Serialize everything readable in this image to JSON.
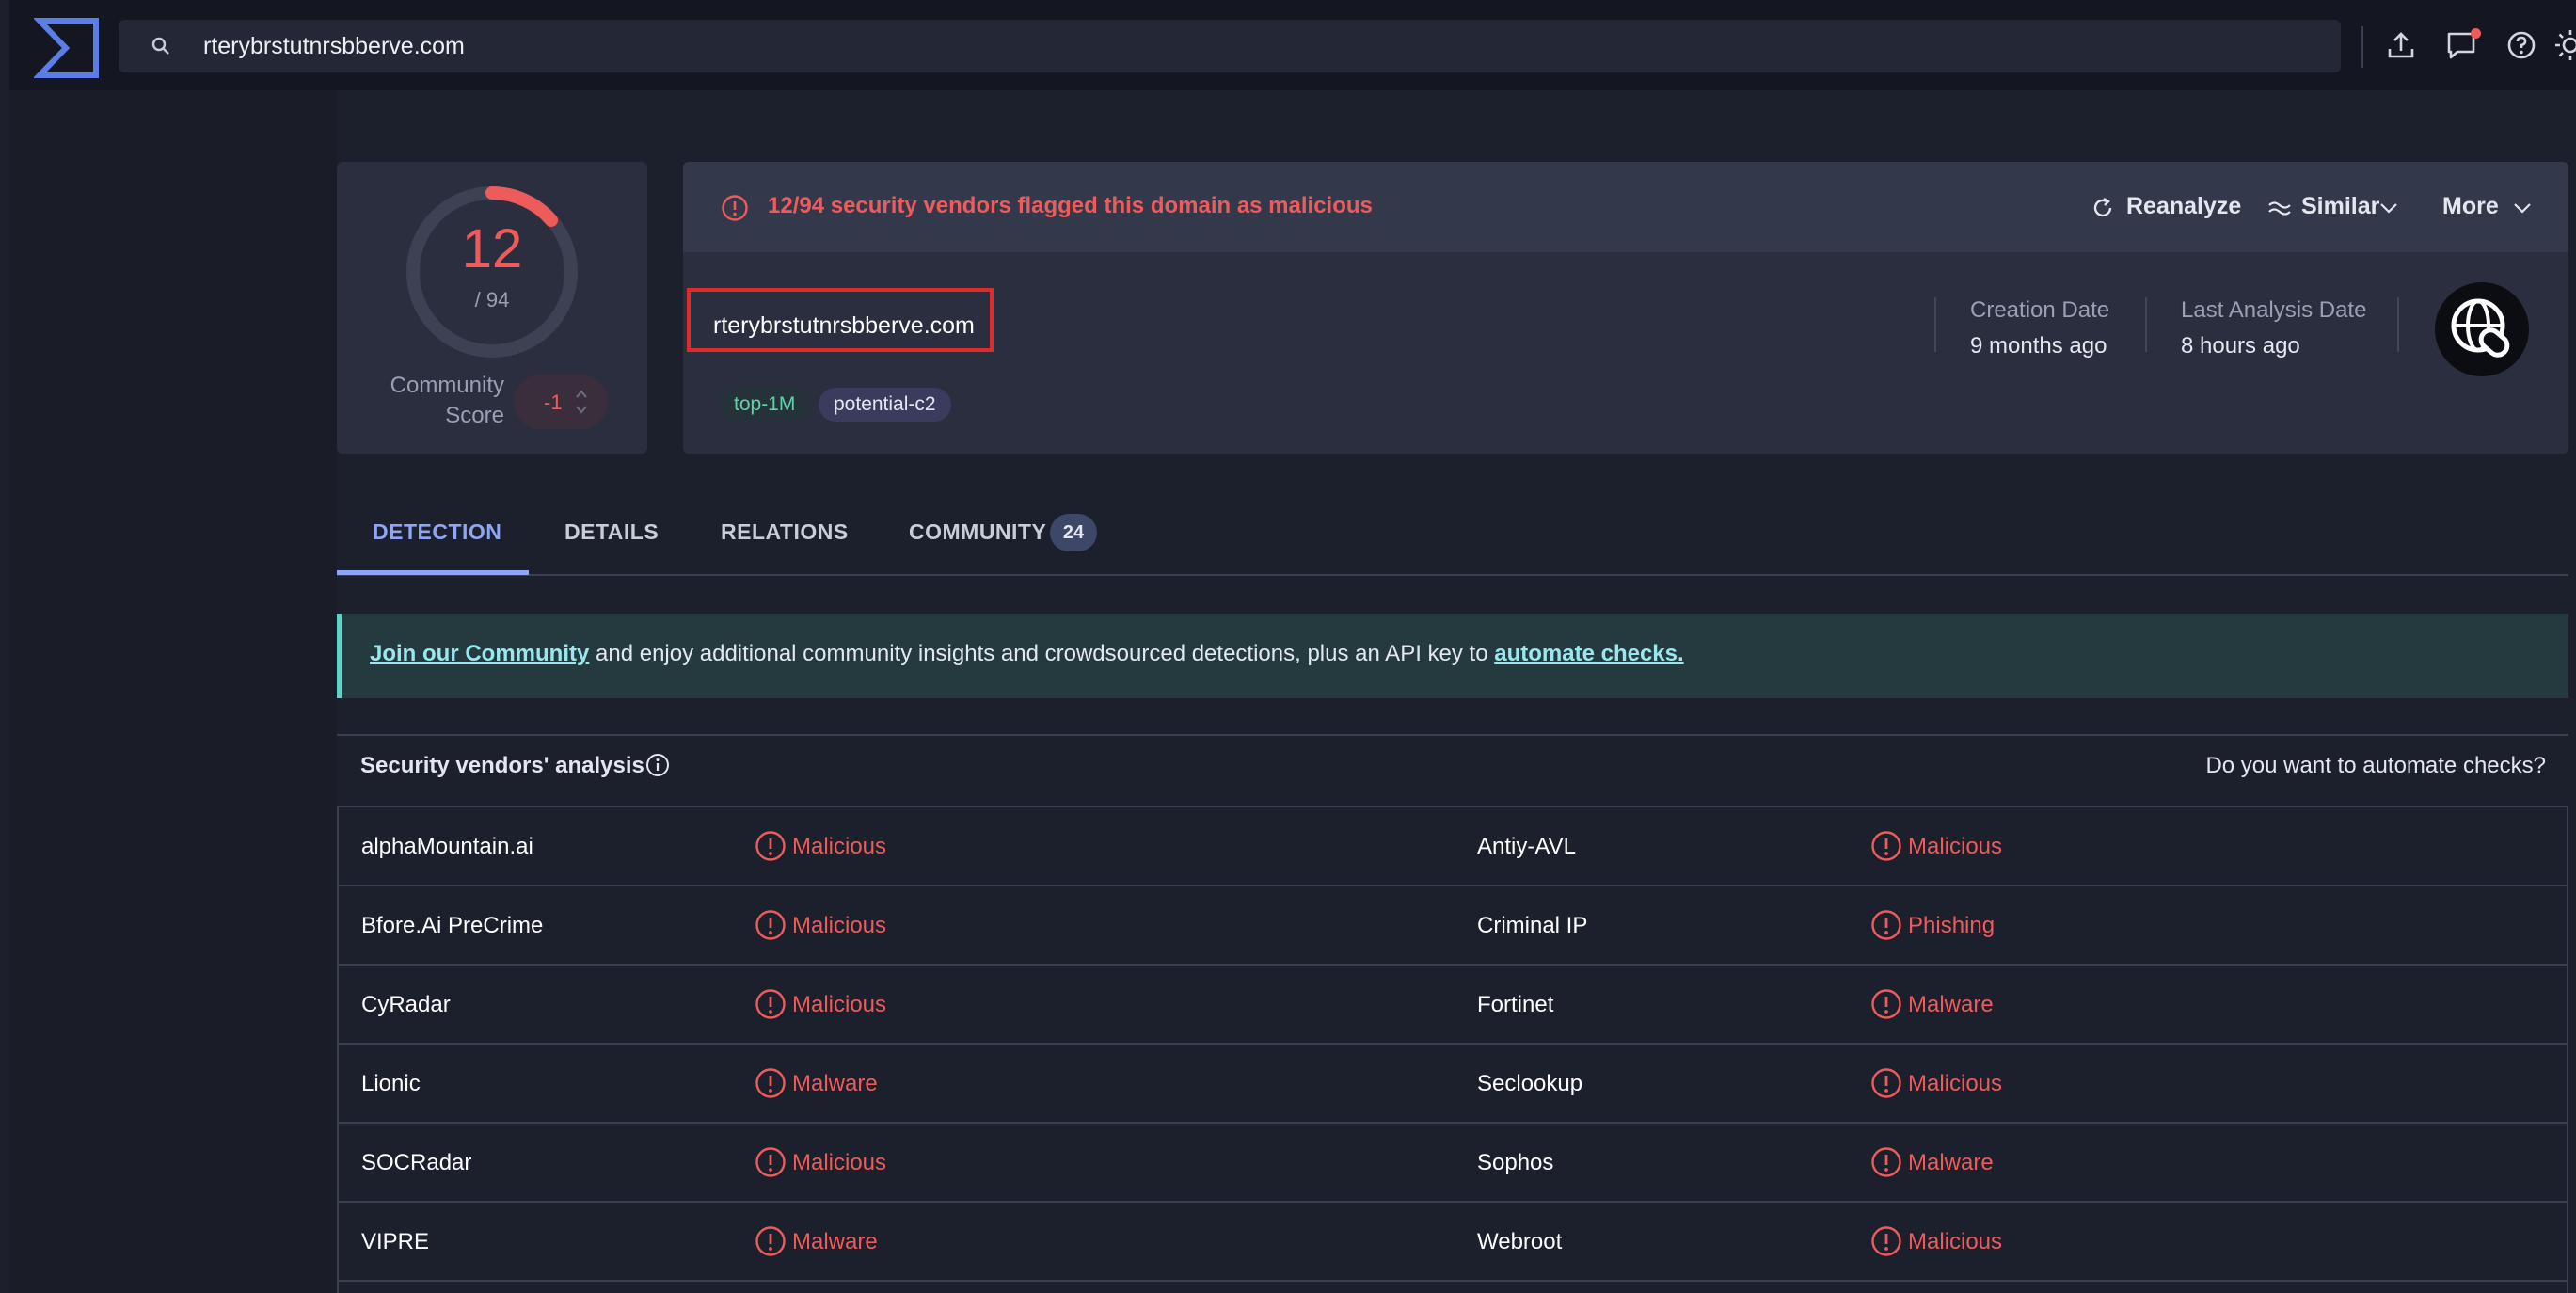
{
  "search": {
    "query": "rterybrstutnrsbberve.com"
  },
  "score": {
    "detections": "12",
    "total": "/ 94",
    "community_label_line1": "Community",
    "community_label_line2": "Score",
    "community_value": "-1"
  },
  "alert": {
    "text": "12/94 security vendors flagged this domain as malicious",
    "reanalyze": "Reanalyze",
    "similar": "Similar",
    "more": "More"
  },
  "domain": {
    "name": "rterybrstutnrsbberve.com",
    "tags": [
      "top-1M",
      "potential-c2"
    ],
    "creation_date_label": "Creation Date",
    "creation_date_value": "9 months ago",
    "last_analysis_label": "Last Analysis Date",
    "last_analysis_value": "8 hours ago"
  },
  "tabs": [
    {
      "label": "DETECTION"
    },
    {
      "label": "DETAILS"
    },
    {
      "label": "RELATIONS"
    },
    {
      "label": "COMMUNITY",
      "badge": "24"
    }
  ],
  "banner": {
    "link1": "Join our Community",
    "middle": " and enjoy additional community insights and crowdsourced detections, plus an API key to ",
    "link2": "automate checks."
  },
  "vendors_section": {
    "title": "Security vendors' analysis",
    "automate_question": "Do you want to automate checks?"
  },
  "vendors": [
    {
      "left": {
        "name": "alphaMountain.ai",
        "verdict": "Malicious"
      },
      "right": {
        "name": "Antiy-AVL",
        "verdict": "Malicious"
      }
    },
    {
      "left": {
        "name": "Bfore.Ai PreCrime",
        "verdict": "Malicious"
      },
      "right": {
        "name": "Criminal IP",
        "verdict": "Phishing"
      }
    },
    {
      "left": {
        "name": "CyRadar",
        "verdict": "Malicious"
      },
      "right": {
        "name": "Fortinet",
        "verdict": "Malware"
      }
    },
    {
      "left": {
        "name": "Lionic",
        "verdict": "Malware"
      },
      "right": {
        "name": "Seclookup",
        "verdict": "Malicious"
      }
    },
    {
      "left": {
        "name": "SOCRadar",
        "verdict": "Malicious"
      },
      "right": {
        "name": "Sophos",
        "verdict": "Malware"
      }
    },
    {
      "left": {
        "name": "VIPRE",
        "verdict": "Malware"
      },
      "right": {
        "name": "Webroot",
        "verdict": "Malicious"
      }
    }
  ],
  "colors": {
    "malicious": "#ee5b5b",
    "accent": "#8ea6f5",
    "background": "#1c1f2c"
  }
}
